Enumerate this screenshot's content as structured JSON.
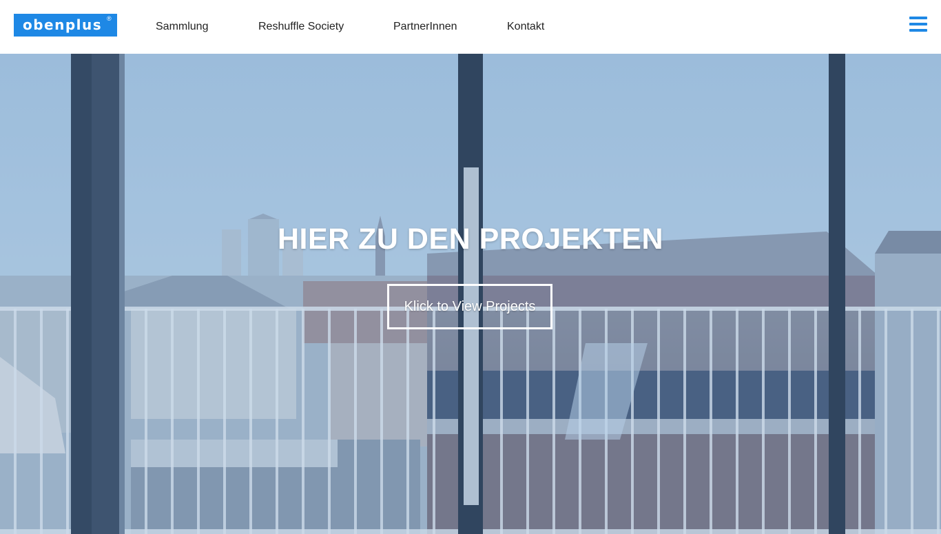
{
  "header": {
    "logo_text": "obenplus",
    "logo_mark": "®",
    "nav": [
      "Sammlung",
      "Reshuffle Society",
      "PartnerInnen",
      "Kontakt"
    ],
    "menu_icon": "hamburger-menu-icon",
    "accent_color": "#1e88e5"
  },
  "hero": {
    "title": "HIER ZU DEN PROJEKTEN",
    "button_label": "Klick to View Projects"
  }
}
